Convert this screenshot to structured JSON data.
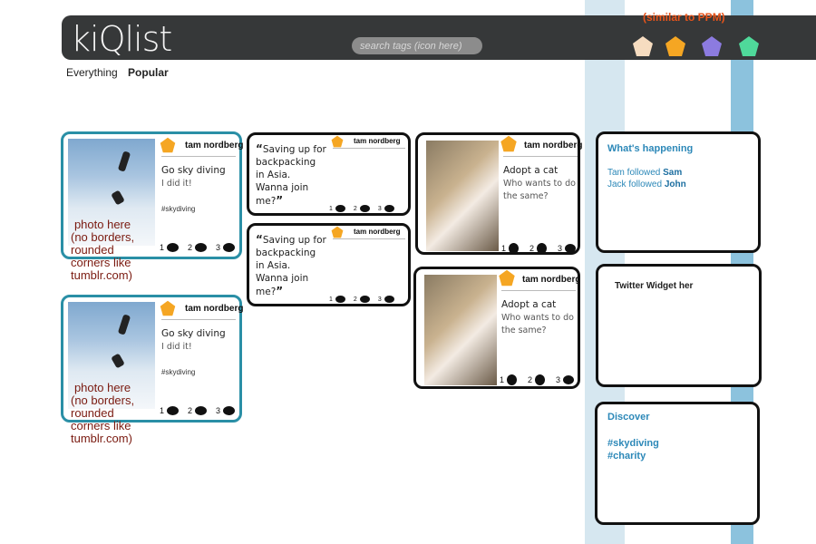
{
  "app": {
    "logo": "kiQlist"
  },
  "search": {
    "placeholder": "search tags (icon here)"
  },
  "header_note": "(similar to PPM)",
  "colors": {
    "header_bg": "#363839",
    "teal": "#2a8fa6",
    "link_blue": "#2c88b8",
    "orange": "#f5a623",
    "note_red": "#e8541b"
  },
  "shape_icons": [
    {
      "name": "peach-pentagon-icon",
      "color": "#f6dcc0"
    },
    {
      "name": "orange-pentagon-icon",
      "color": "#f5a623"
    },
    {
      "name": "purple-pentagon-icon",
      "color": "#8c7be0"
    },
    {
      "name": "green-pentagon-icon",
      "color": "#4fd99a"
    }
  ],
  "nav": {
    "everything": "Everything",
    "popular": "Popular"
  },
  "sky_cards": [
    {
      "author": "tam nordberg",
      "title": "Go sky diving",
      "subtitle": "I did it!",
      "tag": "#skydiving",
      "photo_note": [
        "photo here",
        "(no borders,",
        "rounded",
        "corners like",
        "tumblr.com)"
      ],
      "votes": [
        "1",
        "2",
        "3"
      ]
    },
    {
      "author": "tam nordberg",
      "title": "Go sky diving",
      "subtitle": "I did it!",
      "tag": "#skydiving",
      "photo_note": [
        "photo here",
        "(no borders,",
        "rounded",
        "corners like",
        "tumblr.com)"
      ],
      "votes": [
        "1",
        "2",
        "3"
      ]
    }
  ],
  "quote_cards": [
    {
      "author": "tam nordberg",
      "open_quote": "“",
      "lines": [
        "Saving up for",
        "backpacking",
        "in Asia.",
        "Wanna join",
        "me?"
      ],
      "close_quote": "”",
      "votes": [
        "1",
        "2",
        "3"
      ]
    },
    {
      "author": "tam nordberg",
      "open_quote": "“",
      "lines": [
        "Saving up for",
        "backpacking",
        "in Asia.",
        "Wanna join",
        "me?"
      ],
      "close_quote": "”",
      "votes": [
        "1",
        "2",
        "3"
      ]
    }
  ],
  "cat_cards": [
    {
      "author": "tam nordberg",
      "title": "Adopt a cat",
      "subtitle": [
        "Who wants to do",
        "the same?"
      ],
      "votes": [
        "1",
        "2",
        "3"
      ]
    },
    {
      "author": "tam nordberg",
      "title": "Adopt a cat",
      "subtitle": [
        "Who wants to do",
        "the same?"
      ],
      "votes": [
        "1",
        "2",
        "3"
      ]
    }
  ],
  "happening": {
    "title": "What's happening",
    "items": [
      {
        "prefix": "Tam followed ",
        "name": "Sam"
      },
      {
        "prefix": "Jack followed ",
        "name": "John"
      }
    ]
  },
  "twitter": {
    "label": "Twitter Widget her"
  },
  "discover": {
    "title": "Discover",
    "tags": [
      "#skydiving",
      "#charity"
    ]
  }
}
